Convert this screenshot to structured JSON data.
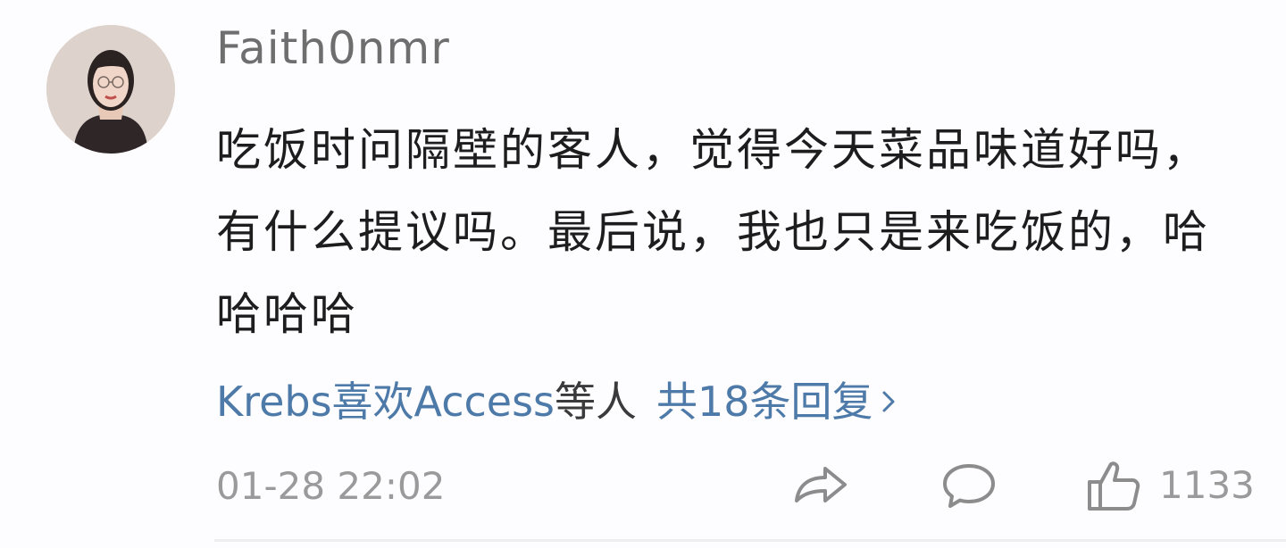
{
  "comment": {
    "username": "Faith0nmr",
    "body": "吃饭时问隔壁的客人，觉得今天菜品味道好吗，有什么提议吗。最后说，我也只是来吃饭的，哈哈哈哈",
    "replies": {
      "first_user": "Krebs喜欢Access",
      "suffix": "等人",
      "count_text": "共18条回复"
    },
    "timestamp": "01-28 22:02",
    "like_count": "1133"
  },
  "icons": {
    "avatar": "user-avatar",
    "share": "share-arrow-icon",
    "comment": "speech-bubble-icon",
    "like": "thumbs-up-icon",
    "chevron": "chevron-right-icon"
  },
  "colors": {
    "link": "#4d7aa8",
    "text": "#1d1d1d",
    "muted": "#9a9a9a",
    "icon": "#8c8c8c"
  }
}
